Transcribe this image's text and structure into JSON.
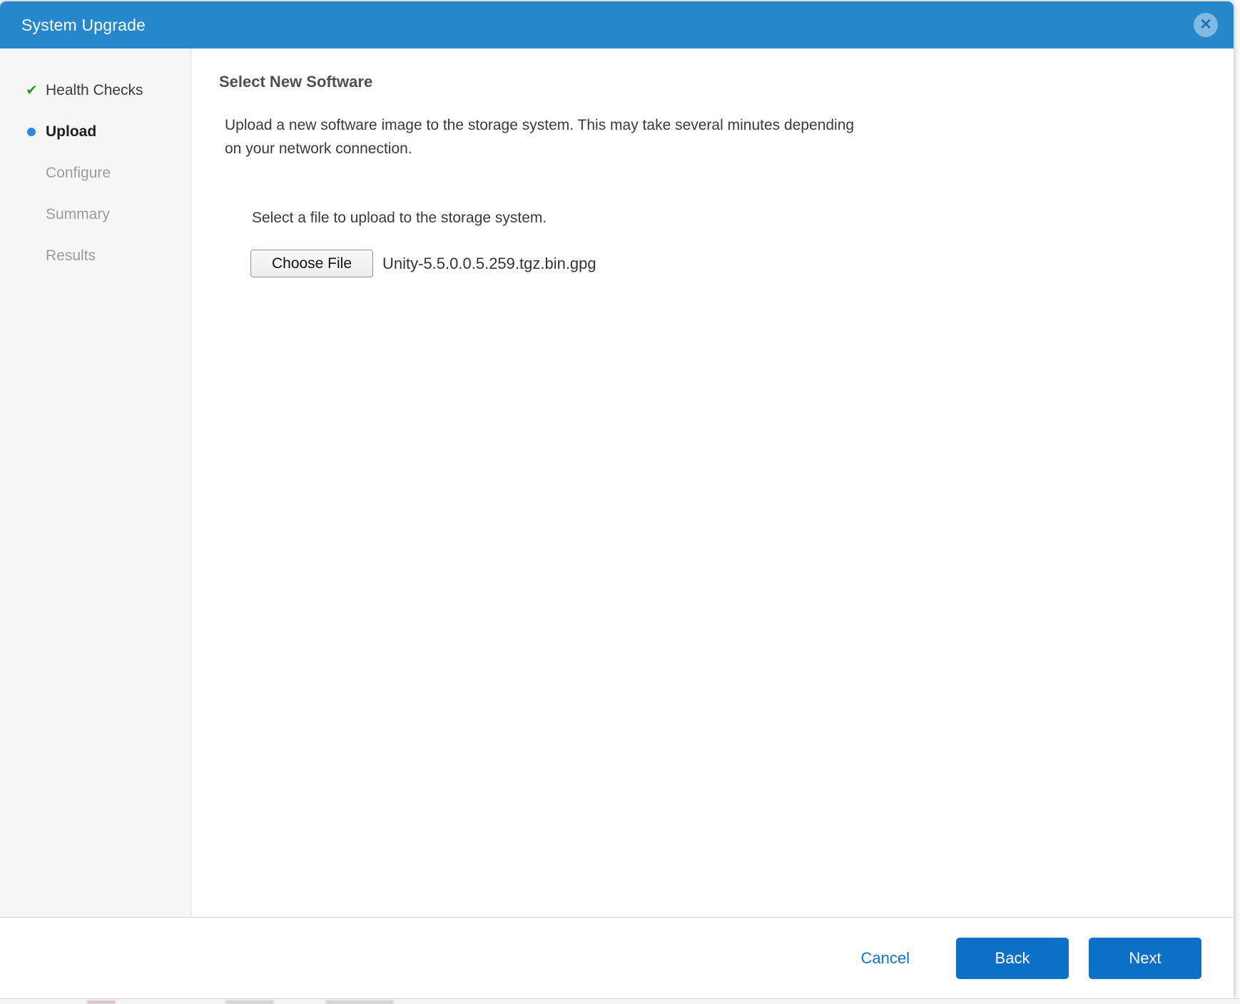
{
  "dialog": {
    "title": "System Upgrade"
  },
  "wizard_steps": [
    {
      "label": "Health Checks",
      "state": "complete",
      "icon": "check-icon"
    },
    {
      "label": "Upload",
      "state": "current",
      "icon": "dot-icon"
    },
    {
      "label": "Configure",
      "state": "pending"
    },
    {
      "label": "Summary",
      "state": "pending"
    },
    {
      "label": "Results",
      "state": "pending"
    }
  ],
  "content": {
    "heading": "Select New Software",
    "description_line1": "Upload a new software image to the storage system. This may take several minutes depending",
    "description_line2": "on your network connection.",
    "file_prompt": "Select a file to upload to the storage system.",
    "choose_file_label": "Choose File",
    "selected_file_name": "Unity-5.5.0.0.5.259.tgz.bin.gpg"
  },
  "footer": {
    "cancel_label": "Cancel",
    "back_label": "Back",
    "next_label": "Next"
  },
  "icons": {
    "close": "circle-x",
    "complete_step": "green-check",
    "current_step": "blue-dot"
  },
  "colors": {
    "titlebar_blue": "#2688cb",
    "primary_button_blue": "#0c70c6",
    "link_blue": "#1374c5",
    "check_green": "#2ca02c",
    "current_step_dot_blue": "#2e8ae0",
    "sidebar_background": "#f7f7f7",
    "inactive_step_gray": "#9b9b9b"
  }
}
